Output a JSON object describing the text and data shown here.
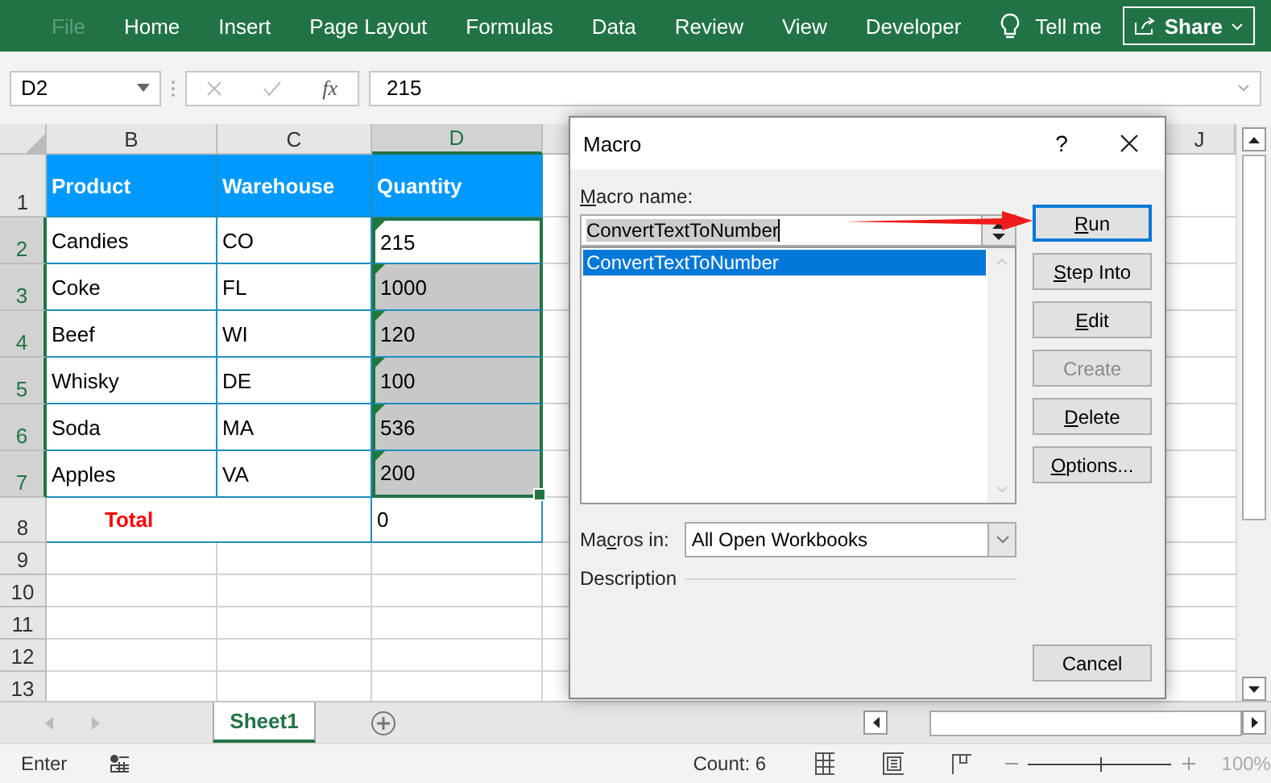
{
  "ribbon": {
    "tabs": [
      {
        "label": "File",
        "disabled": true
      },
      {
        "label": "Home",
        "disabled": false
      },
      {
        "label": "Insert",
        "disabled": false
      },
      {
        "label": "Page Layout",
        "disabled": false
      },
      {
        "label": "Formulas",
        "disabled": false
      },
      {
        "label": "Data",
        "disabled": false
      },
      {
        "label": "Review",
        "disabled": false
      },
      {
        "label": "View",
        "disabled": false
      },
      {
        "label": "Developer",
        "disabled": false
      }
    ],
    "tell_me": "Tell me",
    "share": "Share"
  },
  "formula_bar": {
    "name_box": "D2",
    "function_label": "fx",
    "value": "215"
  },
  "sheet": {
    "columns": [
      {
        "label": "B",
        "selected": false
      },
      {
        "label": "C",
        "selected": false
      },
      {
        "label": "D",
        "selected": true
      },
      {
        "label": "J",
        "selected": false
      }
    ],
    "rows": [
      {
        "number": "1",
        "selected": false,
        "kind": "header",
        "cells": [
          {
            "text": "Product"
          },
          {
            "text": "Warehouse"
          },
          {
            "text": "Quantity"
          }
        ]
      },
      {
        "number": "2",
        "selected": true,
        "kind": "data",
        "cells": [
          {
            "text": "Candies"
          },
          {
            "text": "CO"
          },
          {
            "text": "215",
            "selected": true,
            "active": true,
            "flagged": true
          }
        ]
      },
      {
        "number": "3",
        "selected": true,
        "kind": "data",
        "cells": [
          {
            "text": "Coke"
          },
          {
            "text": "FL"
          },
          {
            "text": "1000",
            "selected": true,
            "active": false,
            "flagged": true
          }
        ]
      },
      {
        "number": "4",
        "selected": true,
        "kind": "data",
        "cells": [
          {
            "text": "Beef"
          },
          {
            "text": "WI"
          },
          {
            "text": "120",
            "selected": true,
            "active": false,
            "flagged": true
          }
        ]
      },
      {
        "number": "5",
        "selected": true,
        "kind": "data",
        "cells": [
          {
            "text": "Whisky"
          },
          {
            "text": "DE"
          },
          {
            "text": "100",
            "selected": true,
            "active": false,
            "flagged": true
          }
        ]
      },
      {
        "number": "6",
        "selected": true,
        "kind": "data",
        "cells": [
          {
            "text": "Soda"
          },
          {
            "text": "MA"
          },
          {
            "text": "536",
            "selected": true,
            "active": false,
            "flagged": true
          }
        ]
      },
      {
        "number": "7",
        "selected": true,
        "kind": "data",
        "cells": [
          {
            "text": "Apples"
          },
          {
            "text": "VA"
          },
          {
            "text": "200",
            "selected": true,
            "active": false,
            "flagged": true
          }
        ]
      },
      {
        "number": "8",
        "selected": false,
        "kind": "total",
        "cells": [
          {
            "text": "Total"
          },
          {
            "text": "0"
          }
        ]
      },
      {
        "number": "9",
        "selected": false,
        "kind": "empty"
      },
      {
        "number": "10",
        "selected": false,
        "kind": "empty"
      },
      {
        "number": "11",
        "selected": false,
        "kind": "empty"
      },
      {
        "number": "12",
        "selected": false,
        "kind": "empty"
      },
      {
        "number": "13",
        "selected": false,
        "kind": "empty"
      }
    ],
    "sheet_tabs": [
      {
        "label": "Sheet1",
        "selected": true
      }
    ]
  },
  "dialog": {
    "title": "Macro",
    "help": "?",
    "name_label": [
      {
        "text": "M",
        "underline": true
      },
      {
        "text": "acro name:",
        "underline": false
      }
    ],
    "name_value": "ConvertTextToNumber",
    "macros": [
      {
        "label": "ConvertTextToNumber",
        "selected": true
      }
    ],
    "macros_in_label": [
      {
        "text": "Ma",
        "underline": false
      },
      {
        "text": "c",
        "underline": true
      },
      {
        "text": "ros in:",
        "underline": false
      }
    ],
    "macros_in_value": "All Open Workbooks",
    "description_label": "Description",
    "buttons": [
      {
        "label": [
          {
            "text": "R",
            "underline": true
          },
          {
            "text": "un",
            "underline": false
          }
        ],
        "default": true,
        "disabled": false
      },
      {
        "label": [
          {
            "text": "S",
            "underline": true
          },
          {
            "text": "tep Into",
            "underline": false
          }
        ],
        "default": false,
        "disabled": false
      },
      {
        "label": [
          {
            "text": "E",
            "underline": true
          },
          {
            "text": "dit",
            "underline": false
          }
        ],
        "default": false,
        "disabled": false
      },
      {
        "label": [
          {
            "text": "Create",
            "underline": false
          }
        ],
        "default": false,
        "disabled": true
      },
      {
        "label": [
          {
            "text": "D",
            "underline": true
          },
          {
            "text": "elete",
            "underline": false
          }
        ],
        "default": false,
        "disabled": false
      },
      {
        "label": [
          {
            "text": "O",
            "underline": true
          },
          {
            "text": "ptions...",
            "underline": false
          }
        ],
        "default": false,
        "disabled": false
      }
    ],
    "cancel": "Cancel"
  },
  "status_bar": {
    "mode": "Enter",
    "count": "Count: 6",
    "zoom": {
      "level": 0.5,
      "reading": "100%"
    }
  }
}
